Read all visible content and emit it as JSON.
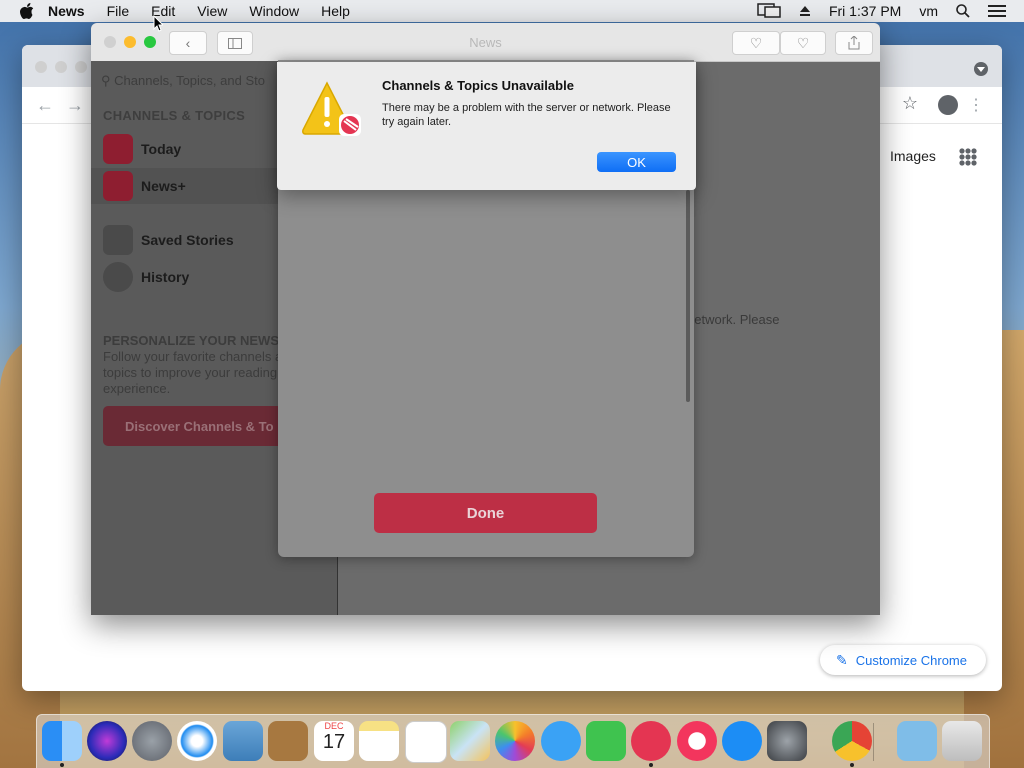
{
  "menubar": {
    "app_name": "News",
    "items": [
      "File",
      "Edit",
      "View",
      "Window",
      "Help"
    ],
    "clock": "Fri 1:37 PM",
    "user": "vm"
  },
  "chrome": {
    "images_link": "Images",
    "customize_label": "Customize Chrome"
  },
  "news": {
    "window_title": "News",
    "search_placeholder": "Channels, Topics, and Sto",
    "section_channels": "CHANNELS & TOPICS",
    "sidebar_items": [
      {
        "label": "Today",
        "icon": "news-today-icon"
      },
      {
        "label": "News+",
        "icon": "news-plus-icon"
      },
      {
        "label": "Saved Stories",
        "icon": "bookmark-icon"
      },
      {
        "label": "History",
        "icon": "clock-icon"
      }
    ],
    "personalize_title": "PERSONALIZE YOUR NEWS",
    "personalize_text": "Follow your favorite channels and topics to improve your reading experience.",
    "discover_button": "Discover Channels & To",
    "main_fragment": "network. Please",
    "done_button": "Done"
  },
  "alert": {
    "title": "Channels & Topics Unavailable",
    "message": "There may be a problem with the server or network. Please try again later.",
    "ok_button": "OK"
  },
  "dock": {
    "apps": [
      "finder-icon",
      "siri-icon",
      "launchpad-icon",
      "safari-icon",
      "preview-icon",
      "contacts-icon",
      "calendar-icon",
      "notes-icon",
      "reminders-icon",
      "maps-icon",
      "photos-icon",
      "messages-icon",
      "facetime-icon",
      "news-icon",
      "music-icon",
      "app-store-icon",
      "system-preferences-icon",
      "chrome-icon",
      "downloads-icon",
      "trash-icon"
    ],
    "calendar_month": "DEC",
    "calendar_day": "17"
  },
  "colors": {
    "accent_red": "#bd2f45",
    "ok_blue": "#1a7cff",
    "chrome_blue": "#1a73e8"
  }
}
